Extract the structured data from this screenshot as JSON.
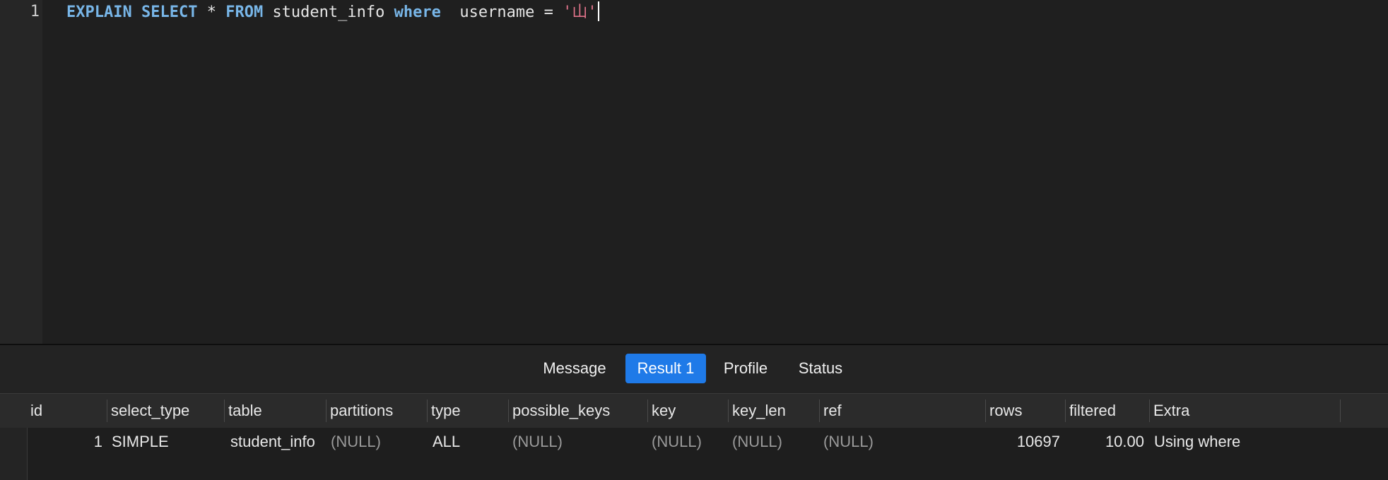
{
  "editor": {
    "line_number": "1",
    "kw_explain": "EXPLAIN",
    "kw_select": "SELECT",
    "star": "*",
    "kw_from": "FROM",
    "table_name": "student_info",
    "kw_where": "where",
    "condition": "username =",
    "string_literal": "'山'"
  },
  "tabs": {
    "message": "Message",
    "result1": "Result 1",
    "profile": "Profile",
    "status": "Status"
  },
  "grid": {
    "columns": [
      "id",
      "select_type",
      "table",
      "partitions",
      "type",
      "possible_keys",
      "key",
      "key_len",
      "ref",
      "rows",
      "filtered",
      "Extra"
    ],
    "rows": [
      [
        "1",
        "SIMPLE",
        "student_info",
        "(NULL)",
        "ALL",
        "(NULL)",
        "(NULL)",
        "(NULL)",
        "(NULL)",
        "10697",
        "10.00",
        "Using where"
      ]
    ]
  },
  "colors": {
    "keyword": "#78b6e8",
    "string": "#e0738a",
    "active_tab": "#1f7ae8"
  }
}
